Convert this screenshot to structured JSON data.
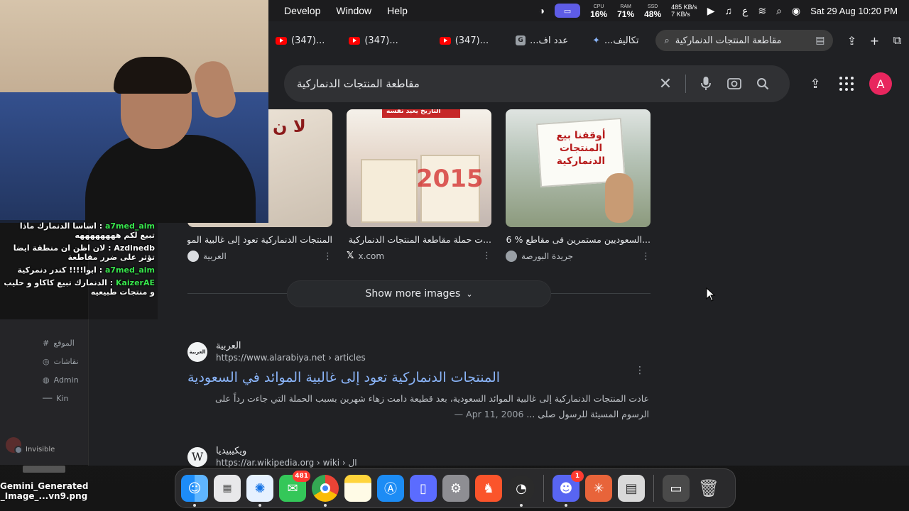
{
  "menubar": {
    "items": [
      "Develop",
      "Window",
      "Help"
    ],
    "cpu_label": "CPU",
    "cpu": "16%",
    "ram_label": "RAM",
    "ram": "71%",
    "ssd_label": "SSD",
    "ssd": "48%",
    "net_down": "485 KB/s",
    "net_up": "7 KB/s",
    "input_lang": "ع",
    "datetime": "Sat 29 Aug  10:20 PM"
  },
  "tabs": [
    {
      "label": "(347)..."
    },
    {
      "label": "(347)..."
    },
    {
      "label": "(347)..."
    },
    {
      "label": "عدد اف..."
    },
    {
      "label": "تكاليف..."
    }
  ],
  "active_tab": {
    "label": "مقاطعة المنتجات الدنماركية"
  },
  "search": {
    "query": "مقاطعة المنتجات الدنماركية"
  },
  "account_initial": "A",
  "images": [
    {
      "title": "المنتجات الدنماركية تعود إلى غالبية الموائد...",
      "source": "العربية"
    },
    {
      "title": "...ت حملة مقاطعة المنتجات الدنماركية الت",
      "source": "x.com"
    },
    {
      "title": "...السعوديين مستمرين فى مقاطع % 46",
      "source": "جريدة البورصة"
    }
  ],
  "image_text": {
    "card1": "لا ن",
    "card2_top": "التاريخ يعيد نفسه",
    "card2_mid": "2015",
    "card3": "أوقفنا بيع المنتجات الدنماركية"
  },
  "show_more": "Show more images",
  "result1": {
    "site": "العربية",
    "favicon_text": "العربية",
    "url": "https://www.alarabiya.net › articles",
    "title": "المنتجات الدنماركية تعود إلى غالبية الموائد في السعودية",
    "date": "Apr 11, 2006 —",
    "snippet": "عادت المنتجات الدنماركية إلى غالبية الموائد السعودية، بعد قطيعة دامت زهاء شهرين بسبب الحملة التي جاءت رداً على الرسوم المسيئة للرسول صلى ..."
  },
  "result2": {
    "site": "ويكيبيديا",
    "favicon_text": "W",
    "url": "https://ar.wikipedia.org › wiki › ال"
  },
  "chat": [
    {
      "user": "a7med_aim",
      "text": "اساسا الدنمارك ماذا تبيع لكم ههههههههه"
    },
    {
      "user": "Azdinedb",
      "text": "لان اظن ان منطقة ايضا تؤثر على ضرر مقاطعة"
    },
    {
      "user": "a7med_aim",
      "text": "ابوا!!!! كندر دنمركية"
    },
    {
      "user": "KaizerAE",
      "text": "الدنمارك تبيع كاكاو و حليب و منتجات طبيعيه"
    }
  ],
  "side_panel": {
    "rows": [
      "الموقع",
      "نقاشات",
      "Admin",
      "Kin"
    ],
    "status": "Invisible"
  },
  "desktop_file": {
    "name": "Gemini_Generated _Image_...vn9.png"
  },
  "dock": {
    "messages_badge": "481",
    "discord_badge": "1"
  }
}
